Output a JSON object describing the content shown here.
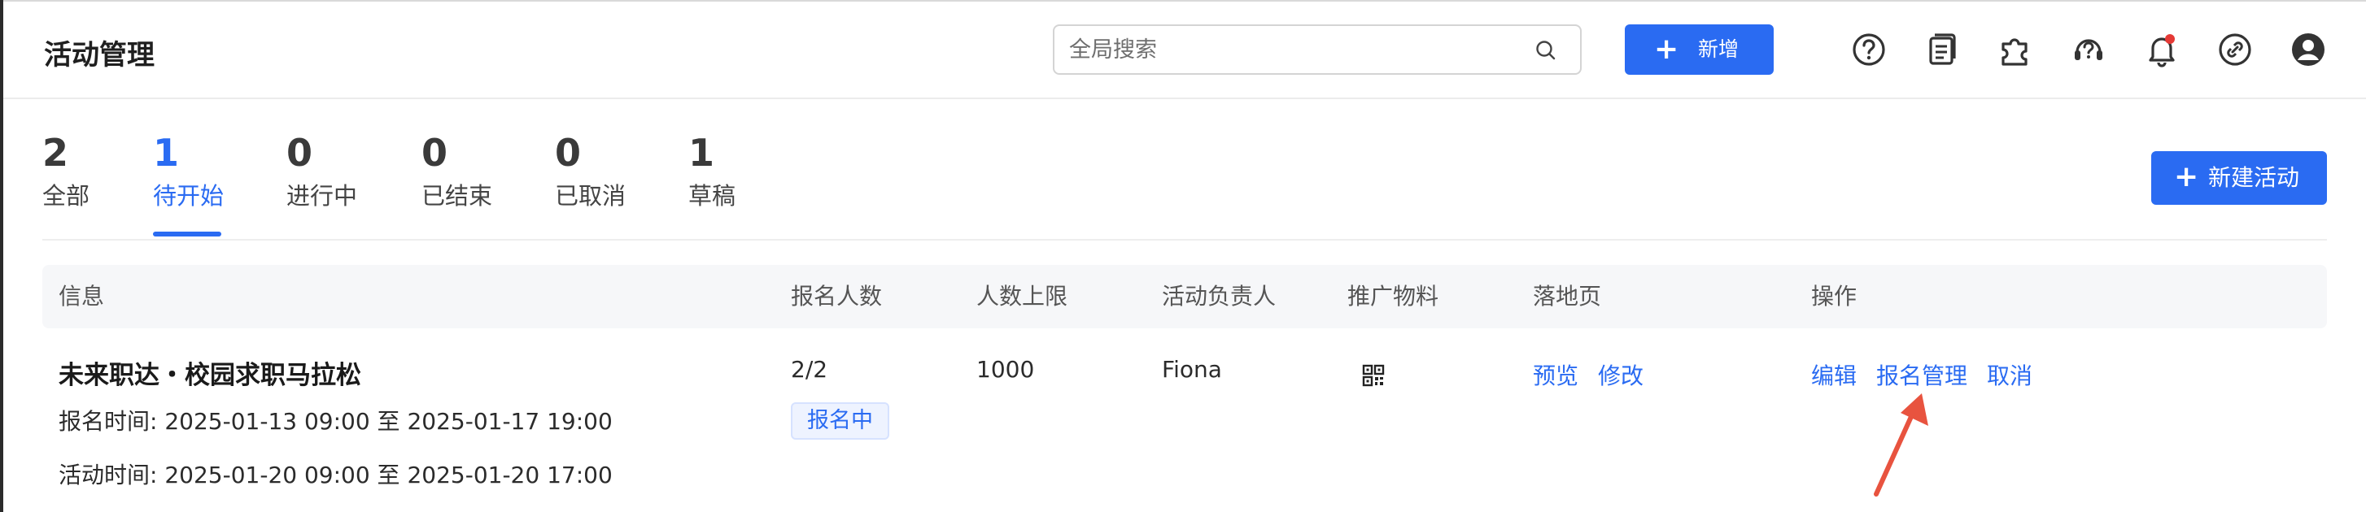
{
  "header": {
    "title": "活动管理",
    "search_placeholder": "全局搜索",
    "add_label": "新增",
    "icons": [
      "help-icon",
      "document-icon",
      "plugin-icon",
      "support-icon",
      "bell-icon",
      "link-icon",
      "user-icon"
    ]
  },
  "tabs": [
    {
      "count": "2",
      "label": "全部"
    },
    {
      "count": "1",
      "label": "待开始"
    },
    {
      "count": "0",
      "label": "进行中"
    },
    {
      "count": "0",
      "label": "已结束"
    },
    {
      "count": "0",
      "label": "已取消"
    },
    {
      "count": "1",
      "label": "草稿"
    }
  ],
  "active_tab": "待开始",
  "new_activity_label": "新建活动",
  "table": {
    "columns": [
      "信息",
      "报名人数",
      "人数上限",
      "活动负责人",
      "推广物料",
      "落地页",
      "操作"
    ],
    "rows": [
      {
        "title": "未来职达・校园求职马拉松",
        "signup_time_label": "报名时间:",
        "signup_time": "2025-01-13 09:00 至 2025-01-17 19:00",
        "activity_time_label": "活动时间:",
        "activity_time": "2025-01-20 09:00 至 2025-01-20 17:00",
        "signups": "2/2",
        "status": "报名中",
        "capacity": "1000",
        "owner": "Fiona",
        "landing_links": [
          "预览",
          "修改"
        ],
        "actions": [
          "编辑",
          "报名管理",
          "取消"
        ]
      }
    ]
  },
  "colors": {
    "primary": "#2a6bf2",
    "annotation_arrow": "#e8533f",
    "notification_dot": "#e53935"
  }
}
